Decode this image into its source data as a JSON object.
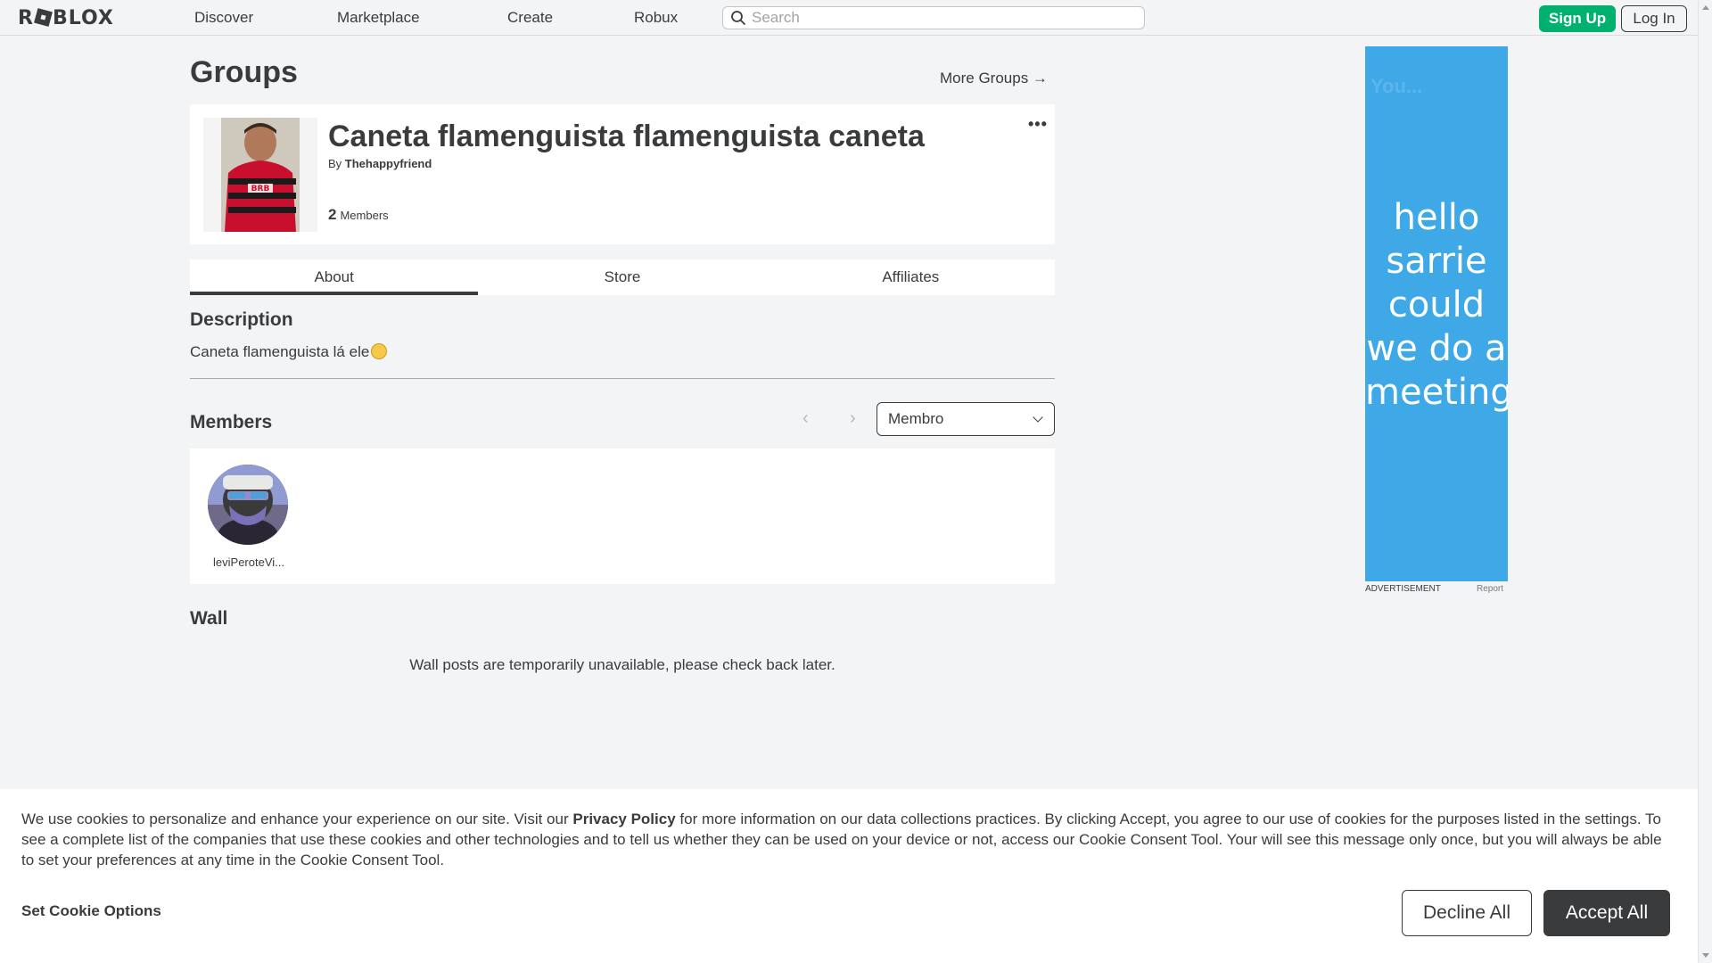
{
  "nav": {
    "logo": "ROBLOX",
    "links": [
      "Discover",
      "Marketplace",
      "Create",
      "Robux"
    ],
    "search_placeholder": "Search",
    "signup_label": "Sign Up",
    "login_label": "Log In"
  },
  "page": {
    "title": "Groups",
    "more_groups": "More Groups →"
  },
  "group": {
    "name": "Caneta flamenguista flamenguista caneta",
    "by_prefix": "By",
    "owner": "Thehappyfriend",
    "member_count": "2",
    "members_label": "Members",
    "more_menu": "•••"
  },
  "tabs": [
    "About",
    "Store",
    "Affiliates"
  ],
  "active_tab": "About",
  "description": {
    "heading": "Description",
    "text": "Caneta flamenguista lá ele"
  },
  "members": {
    "heading": "Members",
    "prev": "‹",
    "next": "›",
    "role_selected": "Membro",
    "list": [
      {
        "name": "leviPeroteVi..."
      }
    ]
  },
  "wall": {
    "heading": "Wall",
    "message": "Wall posts are temporarily unavailable, please check back later."
  },
  "ad": {
    "faded_text": "You...",
    "text": "hello sarrie could we do a meeting",
    "label": "ADVERTISEMENT",
    "report": "Report"
  },
  "cookie": {
    "text_before": "We use cookies to personalize and enhance your experience on our site. Visit our ",
    "privacy_link": "Privacy Policy",
    "text_after": " for more information on our data collections practices. By clicking Accept, you agree to our use of cookies for the purposes listed in the settings. To see a complete list of the companies that use these cookies and other technologies and to tell us whether they can be used on your device or not, access our Cookie Consent Tool. Your will see this message only once, but you will always be able to set your preferences at any time in the Cookie Consent Tool.",
    "options_label": "Set Cookie Options",
    "decline_label": "Decline All",
    "accept_label": "Accept All"
  },
  "colors": {
    "background": "#f2f4f5",
    "text": "#393b3d",
    "signup_green": "#00b06f",
    "ad_blue": "#3fa9e8",
    "accept_dark": "#393b3d"
  }
}
